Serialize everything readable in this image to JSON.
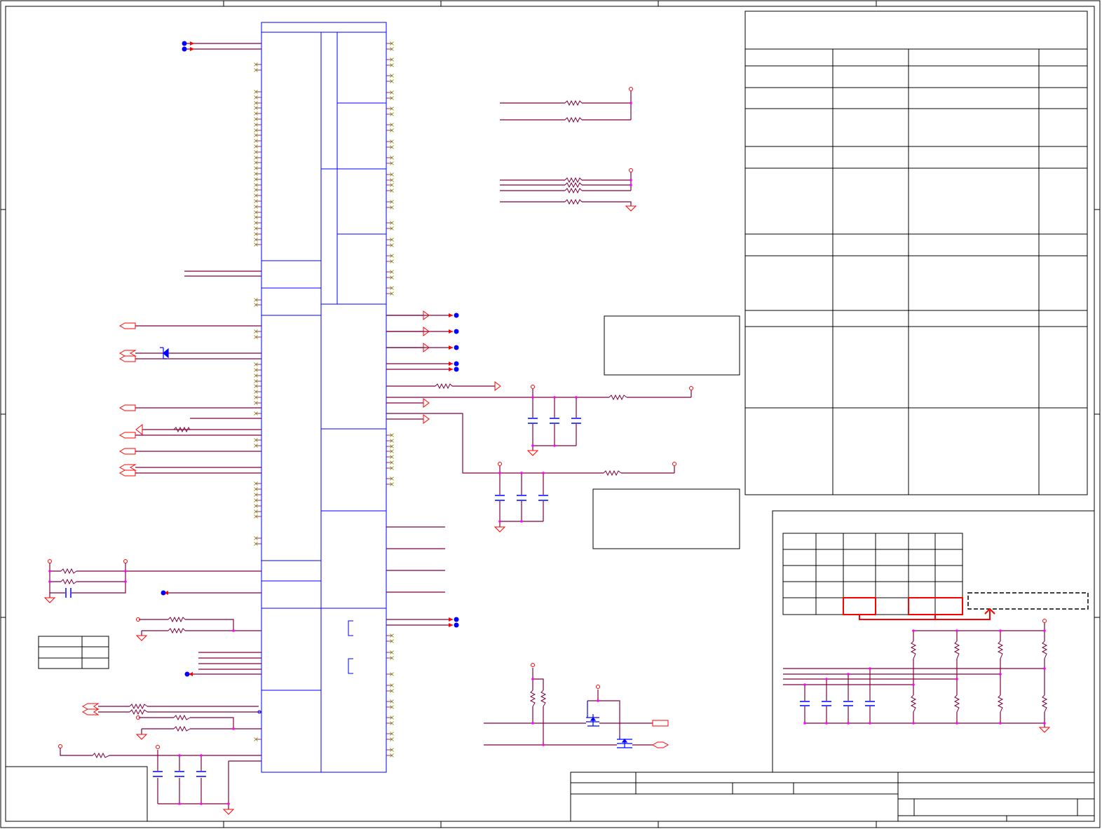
{
  "sheet": {
    "title": "",
    "colors": {
      "border": "#000000",
      "component": "#0000ff",
      "wire": "#800040",
      "power_symbol": "#ff0000",
      "junction": "#ff00ff",
      "no_connect": "#808000",
      "highlight": "#ff0000",
      "page_background": "#ffffff"
    },
    "symbols": [
      "ic-symbol",
      "resistor-symbol",
      "capacitor-symbol",
      "diode-symbol",
      "mosfet-symbol",
      "ground-symbol",
      "power-port-symbol",
      "off-page-connector-symbol",
      "no-connect-marker",
      "net-junction-dot"
    ],
    "tables": [
      "revision-table",
      "strap-option-table",
      "small-option-table",
      "title-block"
    ],
    "visible_text": []
  }
}
